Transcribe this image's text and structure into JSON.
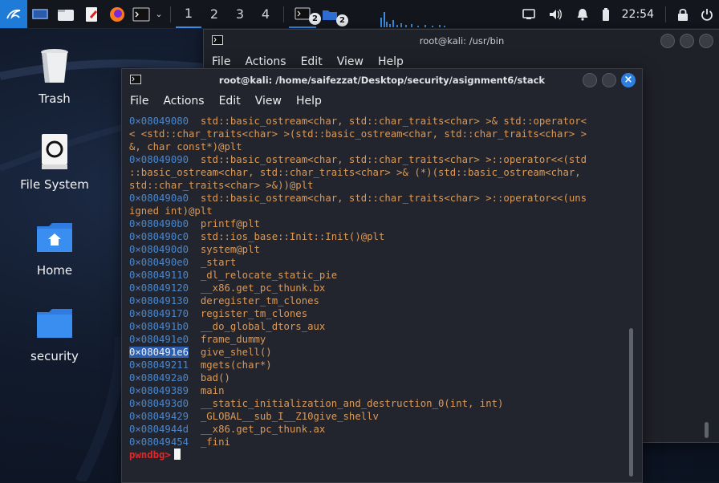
{
  "panel": {
    "workspaces": [
      "1",
      "2",
      "3",
      "4"
    ],
    "task_badges": [
      "2",
      "2"
    ],
    "clock": "22:54"
  },
  "desktop": {
    "icons": [
      {
        "label": "Trash",
        "icon": "trash-icon"
      },
      {
        "label": "File System",
        "icon": "drive-icon"
      },
      {
        "label": "Home",
        "icon": "home-folder-icon"
      },
      {
        "label": "security",
        "icon": "folder-icon"
      }
    ]
  },
  "back_window": {
    "title": "root@kali: /usr/bin",
    "menu": [
      "File",
      "Actions",
      "Edit",
      "View",
      "Help"
    ]
  },
  "front_window": {
    "title": "root@kali: /home/saifezzat/Desktop/security/asignment6/stack",
    "menu": [
      "File",
      "Actions",
      "Edit",
      "View",
      "Help"
    ],
    "lines": [
      {
        "addr": "0×08049080",
        "text": "  std::basic_ostream<char, std::char_traits<char> >& std::operator<"
      },
      {
        "addr": "",
        "text": "< <std::char_traits<char> >(std::basic_ostream<char, std::char_traits<char> >"
      },
      {
        "addr": "",
        "text": "&, char const*)@plt"
      },
      {
        "addr": "0×08049090",
        "text": "  std::basic_ostream<char, std::char_traits<char> >::operator<<(std"
      },
      {
        "addr": "",
        "text": "::basic_ostream<char, std::char_traits<char> >& (*)(std::basic_ostream<char,"
      },
      {
        "addr": "",
        "text": "std::char_traits<char> >&))@plt"
      },
      {
        "addr": "0×080490a0",
        "text": "  std::basic_ostream<char, std::char_traits<char> >::operator<<(uns"
      },
      {
        "addr": "",
        "text": "igned int)@plt"
      },
      {
        "addr": "0×080490b0",
        "text": "  printf@plt"
      },
      {
        "addr": "0×080490c0",
        "text": "  std::ios_base::Init::Init()@plt"
      },
      {
        "addr": "0×080490d0",
        "text": "  system@plt"
      },
      {
        "addr": "0×080490e0",
        "text": "  _start"
      },
      {
        "addr": "0×08049110",
        "text": "  _dl_relocate_static_pie"
      },
      {
        "addr": "0×08049120",
        "text": "  __x86.get_pc_thunk.bx"
      },
      {
        "addr": "0×08049130",
        "text": "  deregister_tm_clones"
      },
      {
        "addr": "0×08049170",
        "text": "  register_tm_clones"
      },
      {
        "addr": "0×080491b0",
        "text": "  __do_global_dtors_aux"
      },
      {
        "addr": "0×080491e0",
        "text": "  frame_dummy"
      },
      {
        "addr": "0×080491e6",
        "text": "  give_shell()",
        "highlight": true
      },
      {
        "addr": "0×08049211",
        "text": "  mgets(char*)"
      },
      {
        "addr": "0×080492a0",
        "text": "  bad()"
      },
      {
        "addr": "0×08049389",
        "text": "  main"
      },
      {
        "addr": "0×080493d0",
        "text": "  __static_initialization_and_destruction_0(int, int)"
      },
      {
        "addr": "0×08049429",
        "text": "  _GLOBAL__sub_I__Z10give_shellv"
      },
      {
        "addr": "0×0804944d",
        "text": "  __x86.get_pc_thunk.ax"
      },
      {
        "addr": "0×08049454",
        "text": "  _fini"
      }
    ],
    "prompt": "pwndbg>"
  },
  "colors": {
    "address": "#4c86c9",
    "symbol": "#d99a5a",
    "prompt": "#e0282a",
    "accent": "#2d7fe0"
  }
}
